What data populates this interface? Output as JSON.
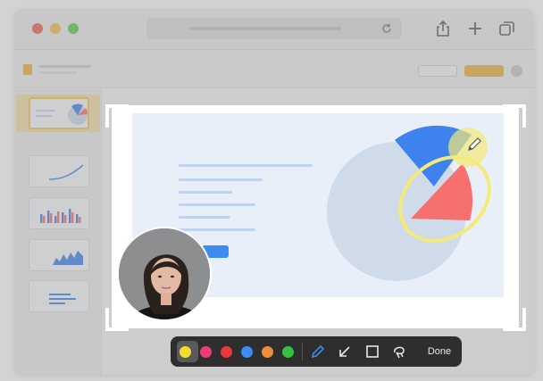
{
  "toolbar": {
    "done_label": "Done",
    "active_color": "#f3de2c",
    "colors": [
      {
        "name": "yellow",
        "hex": "#f3de2c"
      },
      {
        "name": "pink",
        "hex": "#ea3f78"
      },
      {
        "name": "red",
        "hex": "#e83a3a"
      },
      {
        "name": "blue",
        "hex": "#3d8cf0"
      },
      {
        "name": "orange",
        "hex": "#f08d3a"
      },
      {
        "name": "green",
        "hex": "#35c046"
      }
    ],
    "tools": [
      "pen-icon",
      "arrow-icon",
      "rectangle-icon",
      "lasso-icon"
    ]
  },
  "window": {
    "traffic_lights": [
      "#ed5f57",
      "#f5bd4f",
      "#62c655"
    ],
    "toolbar_icons": [
      "share-icon",
      "new-tab-icon",
      "tabs-overview-icon",
      "reload-icon"
    ]
  },
  "app": {
    "accent": "#e8b13a",
    "slide_thumbnails": [
      "pie-chart-thumbnail",
      "line-chart-thumbnail",
      "bar-chart-thumbnail",
      "area-chart-thumbnail",
      "text-thumbnail"
    ]
  },
  "slide": {
    "pie_colors": [
      "#d0dbea",
      "#3d82ed",
      "#f6706f"
    ],
    "button_color": "#3d8cf0",
    "annotation_color": "#f3ea78"
  }
}
